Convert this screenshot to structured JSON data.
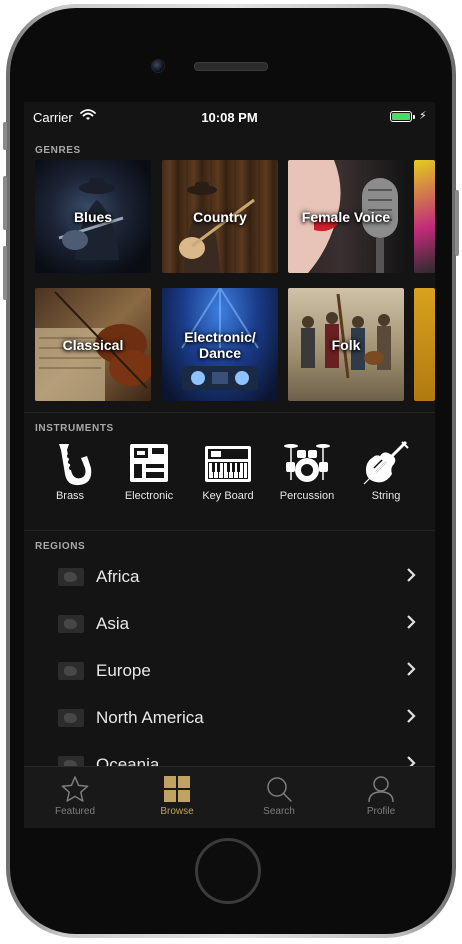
{
  "status_bar": {
    "carrier": "Carrier",
    "time": "10:08 PM",
    "battery_level": 1.0
  },
  "genres": {
    "title": "GENRES",
    "tiles": [
      {
        "label": "Blues"
      },
      {
        "label": "Country"
      },
      {
        "label": "Female Voice"
      },
      {
        "label": "Classical"
      },
      {
        "label": "Electronic/\nDance"
      },
      {
        "label": "Folk"
      }
    ]
  },
  "instruments": {
    "title": "INSTRUMENTS",
    "items": [
      {
        "label": "Brass",
        "icon": "saxophone-icon"
      },
      {
        "label": "Electronic",
        "icon": "circuit-board-icon"
      },
      {
        "label": "Key Board",
        "icon": "keyboard-icon"
      },
      {
        "label": "Percussion",
        "icon": "drum-kit-icon"
      },
      {
        "label": "String",
        "icon": "violin-icon"
      }
    ]
  },
  "regions": {
    "title": "REGIONS",
    "items": [
      {
        "label": "Africa"
      },
      {
        "label": "Asia"
      },
      {
        "label": "Europe"
      },
      {
        "label": "North America"
      },
      {
        "label": "Oceania"
      }
    ]
  },
  "tabbar": {
    "active_color": "#c0a262",
    "tabs": [
      {
        "label": "Featured",
        "icon": "star-icon"
      },
      {
        "label": "Browse",
        "icon": "grid-icon",
        "active": true
      },
      {
        "label": "Search",
        "icon": "search-icon"
      },
      {
        "label": "Profile",
        "icon": "profile-icon"
      }
    ]
  }
}
